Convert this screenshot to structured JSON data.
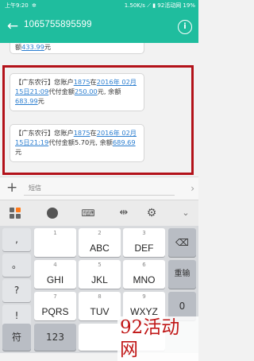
{
  "status_bar": {
    "time": "上午9:20",
    "right": "1.50K/s ⟋ ▮ 92活动网 19%"
  },
  "header": {
    "title": "1065755895599"
  },
  "messages": [
    {
      "parts": [
        [
          "额",
          false
        ],
        [
          "433.99",
          true
        ],
        [
          "元",
          false
        ]
      ]
    },
    {
      "parts": [
        [
          "【广东农行】您账户",
          false
        ],
        [
          "1875",
          true
        ],
        [
          "在",
          false
        ],
        [
          "2016年 02月15日21:09",
          true
        ],
        [
          "代付金额",
          false
        ],
        [
          "250.00",
          true
        ],
        [
          "元, 余额",
          false
        ],
        [
          "683.99",
          true
        ],
        [
          "元",
          false
        ]
      ]
    },
    {
      "parts": [
        [
          "【广东农行】您账户",
          false
        ],
        [
          "1875",
          true
        ],
        [
          "在",
          false
        ],
        [
          "2016年 02月15日21:19",
          true
        ],
        [
          "代付金额5.70元, 余额",
          false
        ],
        [
          "689.69",
          true
        ],
        [
          "元",
          false
        ]
      ]
    }
  ],
  "composer": {
    "placeholder": "短信",
    "plus": "+",
    "send": "›"
  },
  "keyboard": {
    "side_keys": [
      ",",
      "。",
      "?",
      "!"
    ],
    "keys": [
      [
        "1",
        ""
      ],
      [
        "2",
        "ABC"
      ],
      [
        "3",
        "DEF"
      ],
      [
        "4",
        "GHI"
      ],
      [
        "5",
        "JKL"
      ],
      [
        "6",
        "MNO"
      ],
      [
        "7",
        "PQRS"
      ],
      [
        "8",
        "TUV"
      ],
      [
        "9",
        "WXYZ"
      ]
    ],
    "delete": "⌫",
    "retype": "重输",
    "zero": "0",
    "sym": "符",
    "num": "123",
    "zero_key": "0"
  },
  "watermark": "92活动网",
  "colors": {
    "accent": "#1fbd9e",
    "highlight_frame": "#b3121a",
    "link": "#2d7fd0"
  }
}
